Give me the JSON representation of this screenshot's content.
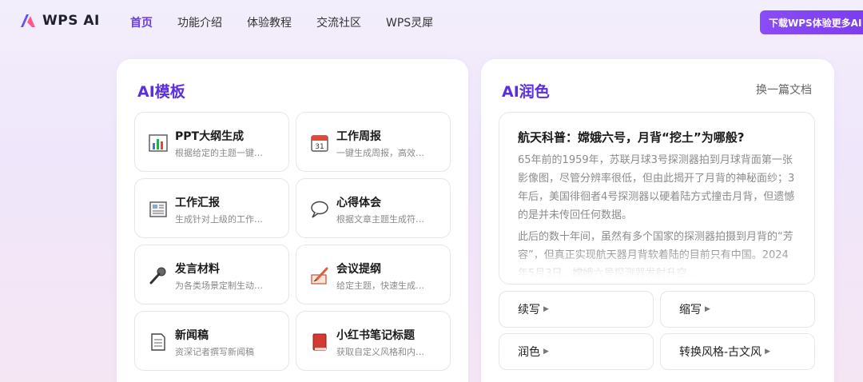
{
  "brand": {
    "name": "WPS AI"
  },
  "nav": {
    "items": [
      "首页",
      "功能介绍",
      "体验教程",
      "交流社区",
      "WPS灵犀"
    ],
    "active_index": 0
  },
  "download_button": {
    "label": "下载WPS体验更多AI",
    "icon": "chevron-down-icon"
  },
  "templates": {
    "title": "AI模板",
    "cards": [
      {
        "title": "PPT大纲生成",
        "desc": "根据给定的主题一键…",
        "icon": "bar-chart-icon"
      },
      {
        "title": "工作周报",
        "desc": "一键生成周报，高效…",
        "icon": "calendar-icon"
      },
      {
        "title": "工作汇报",
        "desc": "生成针对上级的工作…",
        "icon": "newspaper-icon"
      },
      {
        "title": "心得体会",
        "desc": "根据文章主题生成符…",
        "icon": "speech-bubble-icon"
      },
      {
        "title": "发言材料",
        "desc": "为各类场景定制生动…",
        "icon": "microphone-icon"
      },
      {
        "title": "会议提纲",
        "desc": "给定主题，快速生成…",
        "icon": "pencil-note-icon"
      },
      {
        "title": "新闻稿",
        "desc": "资深记者撰写新闻稿",
        "icon": "document-icon"
      },
      {
        "title": "小红书笔记标题",
        "desc": "获取自定义风格和内…",
        "icon": "red-book-icon"
      }
    ]
  },
  "polish": {
    "title": "AI润色",
    "switch_label": "换一篇文档",
    "article": {
      "title": "航天科普：嫦娥六号，月背“挖土”为哪般?",
      "paragraphs": [
        "65年前的1959年，苏联月球3号探测器拍到月球背面第一张影像图，尽管分辨率很低，但由此揭开了月背的神秘面纱；3年后，美国徘徊者4号探测器以硬着陆方式撞击月背，但遗憾的是并未传回任何数据。",
        "此后的数十年间，虽然有多个国家的探测器拍摄到月背的“芳容”，但真正实现航天器月背软着陆的目前只有中国。2024年5月3日，嫦娥六号探测器发射升空..."
      ]
    },
    "actions": [
      "续写",
      "缩写",
      "润色",
      "转换风格-古文风"
    ]
  },
  "colors": {
    "accent": "#6a3cf0",
    "button": "#7a3cf0",
    "title": "#5a2fe0"
  }
}
